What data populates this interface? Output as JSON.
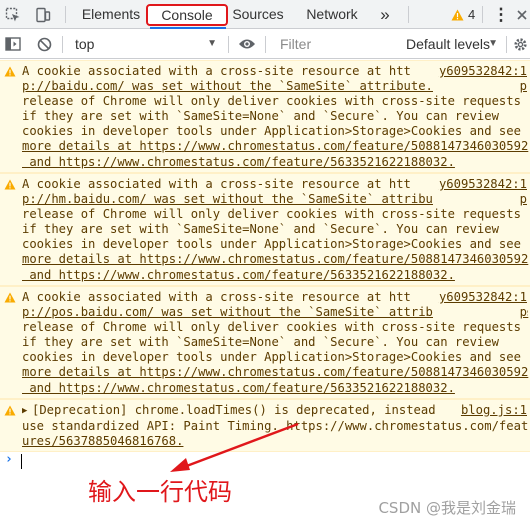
{
  "devtools": {
    "tabs": [
      {
        "label": "Elements"
      },
      {
        "label": "Console"
      },
      {
        "label": "Sources"
      },
      {
        "label": "Network"
      }
    ],
    "more_tabs": "»",
    "warning_count": "4",
    "menu": "⋮"
  },
  "toolbar": {
    "context": "top",
    "filter_placeholder": "Filter",
    "levels": "Default levels"
  },
  "messages": [
    {
      "source": "y609532842:1\np",
      "lines": [
        "A cookie associated with a cross-site resource at htt",
        "p://baidu.com/ was set without the `SameSite` attribute. A future",
        "release of Chrome will only deliver cookies with cross-site requests",
        "if they are set with `SameSite=None` and `Secure`. You can review",
        "cookies in developer tools under Application>Storage>Cookies and see",
        "more details at https://www.chromestatus.com/feature/5088147346030592",
        " and https://www.chromestatus.com/feature/5633521622188032."
      ]
    },
    {
      "source": "y609532842:1\np",
      "lines": [
        "A cookie associated with a cross-site resource at htt",
        "p://hm.baidu.com/ was set without the `SameSite` attribute. A future",
        "release of Chrome will only deliver cookies with cross-site requests",
        "if they are set with `SameSite=None` and `Secure`. You can review",
        "cookies in developer tools under Application>Storage>Cookies and see",
        "more details at https://www.chromestatus.com/feature/5088147346030592",
        " and https://www.chromestatus.com/feature/5633521622188032."
      ]
    },
    {
      "source": "y609532842:1\np",
      "lines": [
        "A cookie associated with a cross-site resource at htt",
        "p://pos.baidu.com/ was set without the `SameSite` attribute. A future",
        "release of Chrome will only deliver cookies with cross-site requests",
        "if they are set with `SameSite=None` and `Secure`. You can review",
        "cookies in developer tools under Application>Storage>Cookies and see",
        "more details at https://www.chromestatus.com/feature/5088147346030592",
        " and https://www.chromestatus.com/feature/5633521622188032."
      ]
    },
    {
      "source": "blog.js:1",
      "lines": [
        "[Deprecation] chrome.loadTimes() is deprecated, instead",
        "use standardized API: Paint Timing. https://www.chromestatus.com/feat",
        "ures/5637885046816768."
      ]
    }
  ],
  "prompt_symbol": "›",
  "annotation": "输入一行代码",
  "watermark": "CSDN @我是刘金瑞",
  "colors": {
    "highlight_red": "#e0171b",
    "warning_bg": "#fffbe5",
    "warning_text": "#5c3c00",
    "warning_icon": "#f9ab00",
    "accent_blue": "#1a73e8"
  }
}
